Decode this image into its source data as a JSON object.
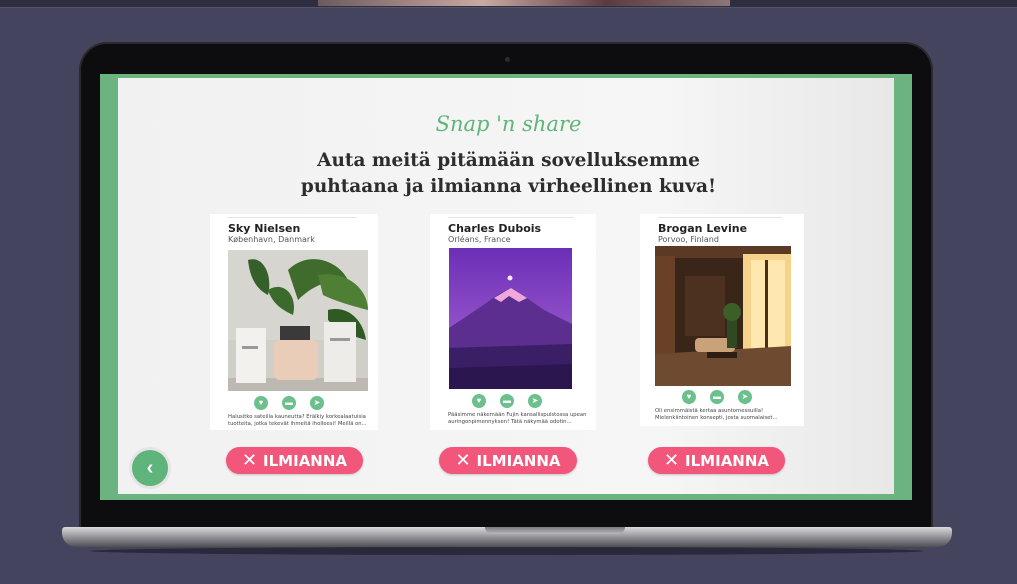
{
  "app": {
    "eyebrow": "Snap 'n share",
    "headline_line1": "Auta meitä pitämään sovelluksemme",
    "headline_line2": "puhtaana ja ilmianna virheellinen kuva!"
  },
  "posts": [
    {
      "name": "Sky Nielsen",
      "location": "København, Danmark",
      "caption": "Halusitko sateilla kauneutta? Erälkiy korkealaatuisia tuotteita, jotka tekevät ihmeitä iholleesi! Meillä on...",
      "report_label": "ILMIANNA"
    },
    {
      "name": "Charles Dubois",
      "location": "Orléans, France",
      "caption": "Pääsimme näkemään Fujin kansallispuistossa upean auringonpimennyksen! Tätä näkymää odotin...",
      "report_label": "ILMIANNA"
    },
    {
      "name": "Brogan Levine",
      "location": "Porvoo, Finland",
      "caption": "Oli ensimmäistä kertaa asuntomessuilla! Mielenkiintoinen konsepti, josta suomalaiset...",
      "report_label": "ILMIANNA"
    }
  ],
  "icons": {
    "like": "heart-icon",
    "comment": "comment-icon",
    "share": "share-icon",
    "back": "chevron-left-icon",
    "report": "close-icon"
  },
  "glyphs": {
    "like": "♥",
    "comment": "▬",
    "share": "➤",
    "back": "‹",
    "report": "✕"
  },
  "colors": {
    "accent_green": "#5fb578",
    "report_pink": "#f2567a",
    "background": "#44445e"
  }
}
